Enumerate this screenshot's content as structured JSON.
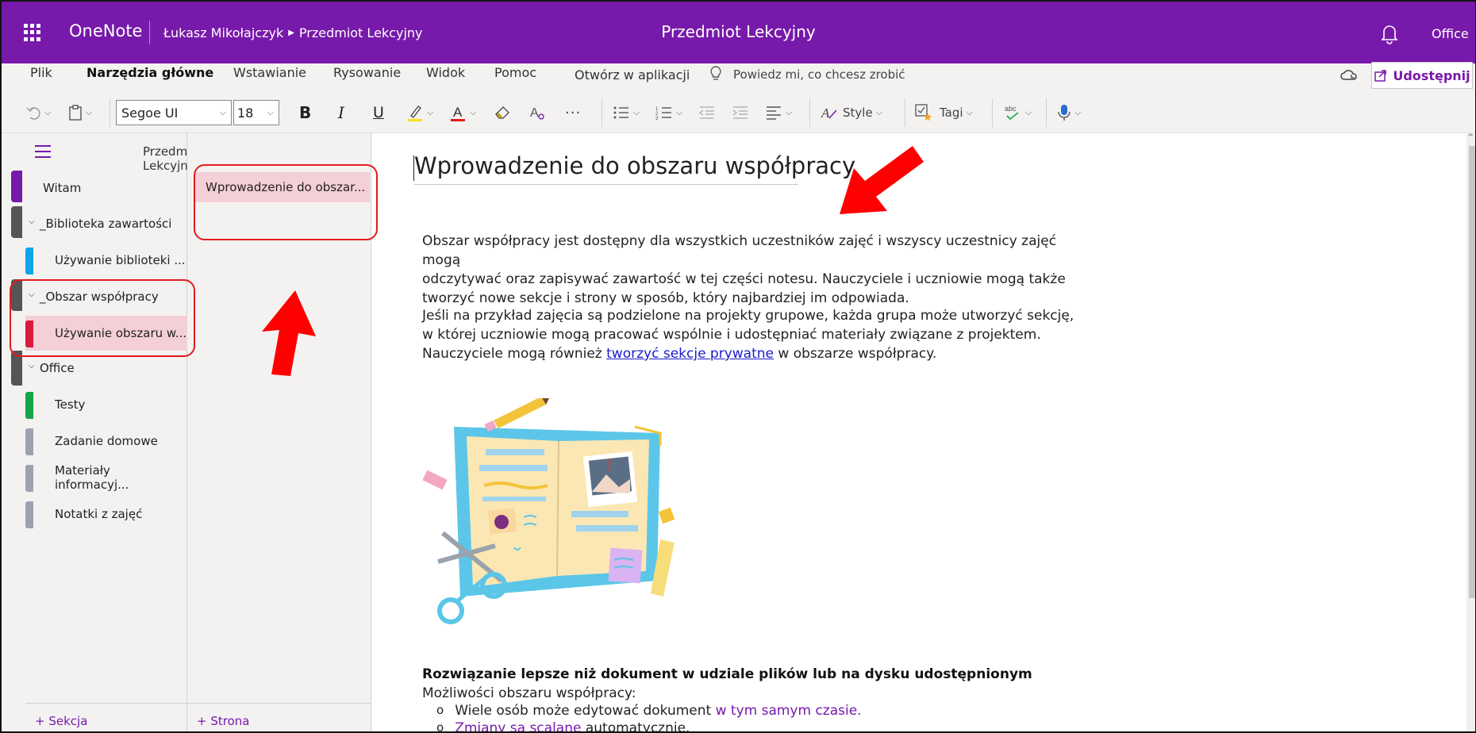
{
  "titlebar": {
    "app_name": "OneNote",
    "breadcrumb_user": "Łukasz Mikołajczyk",
    "breadcrumb_notebook": "Przedmiot Lekcyjny",
    "center_title": "Przedmiot Lekcyjny",
    "office": "Office",
    "bg_color": "#7719aa"
  },
  "ribbon": {
    "tabs": [
      "Plik",
      "Narzędzia główne",
      "Wstawianie",
      "Rysowanie",
      "Widok",
      "Pomoc"
    ],
    "active_tab": "Narzędzia główne",
    "open_in_app": "Otwórz w aplikacji",
    "tell_me": "Powiedz mi, co chcesz zrobić",
    "share": "Udostępnij"
  },
  "toolbar": {
    "font": "Segoe UI",
    "size": "18",
    "bold": "B",
    "italic": "I",
    "underline": "U",
    "more": "···",
    "style": "Style",
    "tags": "Tagi"
  },
  "nav": {
    "notebook_title": "Przedmiot Lekcyjny",
    "sections": [
      {
        "label": "Witam",
        "color": "#ffffff",
        "type": "section"
      },
      {
        "label": "_Biblioteka zawartości",
        "type": "group"
      },
      {
        "label": "Używanie biblioteki ...",
        "color": "#0ea5e9",
        "type": "section"
      },
      {
        "label": "_Obszar współpracy",
        "type": "group"
      },
      {
        "label": "Używanie obszaru w...",
        "color": "#d81b3c",
        "type": "section"
      },
      {
        "label": "Office",
        "type": "group"
      },
      {
        "label": "Testy",
        "color": "#16a34a",
        "type": "section"
      },
      {
        "label": "Zadanie domowe",
        "color": "#9ca3af",
        "type": "section"
      },
      {
        "label": "Materiały informacyj...",
        "color": "#9ca3af",
        "type": "section"
      },
      {
        "label": "Notatki z zajęć",
        "color": "#9ca3af",
        "type": "section"
      }
    ],
    "add_section": "+ Sekcja"
  },
  "pages": {
    "items": [
      "Wprowadzenie do obszar..."
    ],
    "add_page": "+ Strona"
  },
  "content": {
    "title": "Wprowadzenie do obszaru współpracy",
    "p1_line1": "Obszar współpracy jest dostępny dla wszystkich uczestników zajęć i wszyscy uczestnicy zajęć mogą",
    "p1_line2": "odczytywać oraz zapisywać zawartość w tej części notesu. Nauczyciele i uczniowie mogą także",
    "p1_line3": "tworzyć nowe sekcje i strony w sposób, który najbardziej im odpowiada.",
    "p2_line1": "Jeśli na przykład zajęcia są podzielone na projekty grupowe, każda grupa może utworzyć sekcję,",
    "p2_line2": "w której uczniowie mogą pracować wspólnie i udostępniać materiały związane z projektem.",
    "p2_line3_a": "Nauczyciele mogą również ",
    "p2_link": "tworzyć sekcje prywatne",
    "p2_line3_b": " w obszarze współpracy.",
    "heading": "Rozwiązanie lepsze niż dokument w udziale plików lub na dysku udostępnionym",
    "possibilities": "Możliwości obszaru współpracy:",
    "bullet1_a": "Wiele osób może edytować dokument ",
    "bullet1_b": "w tym samym czasie.",
    "bullet2_a": "Zmiany są scalane",
    "bullet2_b": " automatycznie.",
    "bullet_mark": "o"
  },
  "colors": {
    "accent": "#7719aa",
    "selected_bg": "#f4cfd6",
    "highlight_red": "#e31b1b"
  }
}
